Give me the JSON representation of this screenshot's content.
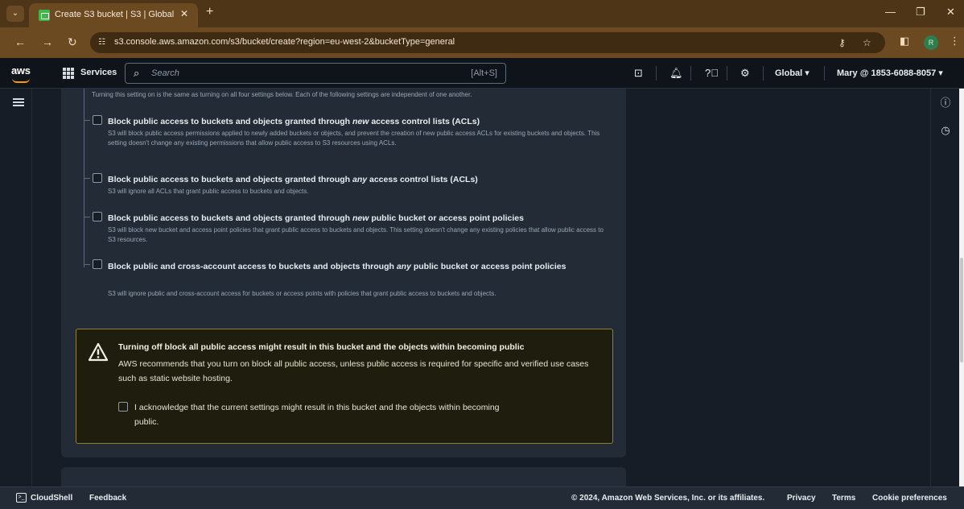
{
  "browser": {
    "tab_title": "Create S3 bucket | S3 | Global",
    "url": "s3.console.aws.amazon.com/s3/bucket/create?region=eu-west-2&bucketType=general",
    "profile_initial": "R"
  },
  "aws_nav": {
    "logo": "aws",
    "services_label": "Services",
    "search_placeholder": "Search",
    "search_shortcut": "[Alt+S]",
    "region": "Global ▾",
    "account": "Mary @ 1853-6088-8057 ▾"
  },
  "content": {
    "intro": "Turning this setting on is the same as turning on all four settings below. Each of the following settings are independent of one another.",
    "options": [
      {
        "title_before": "Block public access to buckets and objects granted through ",
        "title_em": "new",
        "title_after": " access control lists (ACLs)",
        "description": "S3 will block public access permissions applied to newly added buckets or objects, and prevent the creation of new public access ACLs for existing buckets and objects. This setting doesn't change any existing permissions that allow public access to S3 resources using ACLs."
      },
      {
        "title_before": "Block public access to buckets and objects granted through ",
        "title_em": "any",
        "title_after": " access control lists (ACLs)",
        "description": "S3 will ignore all ACLs that grant public access to buckets and objects."
      },
      {
        "title_before": "Block public access to buckets and objects granted through ",
        "title_em": "new",
        "title_after": " public bucket or access point policies",
        "description": "S3 will block new bucket and access point policies that grant public access to buckets and objects. This setting doesn't change any existing policies that allow public access to S3 resources."
      },
      {
        "title_before": "Block public and cross-account access to buckets and objects through ",
        "title_em": "any",
        "title_after": " public bucket or access point policies",
        "description": "S3 will ignore public and cross-account access for buckets or access points with policies that grant public access to buckets and objects."
      }
    ],
    "warning": {
      "title": "Turning off block all public access might result in this bucket and the objects within becoming public",
      "body": "AWS recommends that you turn on block all public access, unless public access is required for specific and verified use cases such as static website hosting.",
      "acknowledge": "I acknowledge that the current settings might result in this bucket and the objects within becoming public."
    }
  },
  "footer": {
    "cloudshell": "CloudShell",
    "feedback": "Feedback",
    "copyright": "© 2024, Amazon Web Services, Inc. or its affiliates.",
    "privacy": "Privacy",
    "terms": "Terms",
    "cookie_preferences": "Cookie preferences"
  },
  "colors": {
    "browser_frame": "#6b4a22",
    "console_bg": "#161d26",
    "panel_bg": "#222b36",
    "warning_border": "#8e8232",
    "aws_orange": "#ff9900"
  },
  "icons": [
    "tab-list-icon",
    "s3-favicon",
    "close-icon",
    "new-tab-icon",
    "minimize-icon",
    "maximize-icon",
    "back-icon",
    "forward-icon",
    "reload-icon",
    "site-info-icon",
    "password-key-icon",
    "bookmark-star-icon",
    "side-panel-icon",
    "kebab-menu-icon",
    "services-grid-icon",
    "search-icon",
    "cloudshell-icon",
    "bell-icon",
    "help-icon",
    "gear-icon",
    "hamburger-icon",
    "info-icon",
    "history-icon",
    "warning-icon"
  ]
}
